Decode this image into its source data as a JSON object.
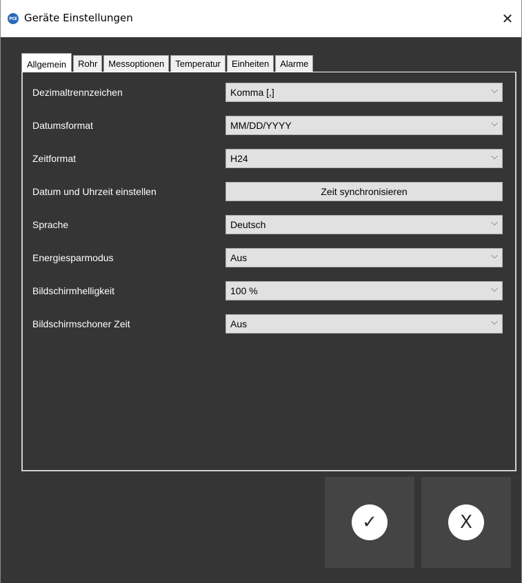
{
  "window": {
    "title": "Geräte Einstellungen",
    "icon_text": "PCE",
    "close_glyph": "✕"
  },
  "tabs": [
    {
      "label": "Allgemein",
      "active": true
    },
    {
      "label": "Rohr"
    },
    {
      "label": "Messoptionen"
    },
    {
      "label": "Temperatur"
    },
    {
      "label": "Einheiten"
    },
    {
      "label": "Alarme"
    }
  ],
  "settings": [
    {
      "label": "Dezimaltrennzeichen",
      "value": "Komma [,]",
      "type": "dropdown"
    },
    {
      "label": "Datumsformat",
      "value": "MM/DD/YYYY",
      "type": "dropdown"
    },
    {
      "label": "Zeitformat",
      "value": "H24",
      "type": "dropdown"
    },
    {
      "label": "Datum und Uhrzeit einstellen",
      "value": "Zeit synchronisieren",
      "type": "button"
    },
    {
      "label": "Sprache",
      "value": "Deutsch",
      "type": "dropdown"
    },
    {
      "label": "Energiesparmodus",
      "value": "Aus",
      "type": "dropdown"
    },
    {
      "label": "Bildschirmhelligkeit",
      "value": "100 %",
      "type": "dropdown"
    },
    {
      "label": "Bildschirmschoner Zeit",
      "value": "Aus",
      "type": "dropdown"
    }
  ],
  "icons": {
    "dropdown": "chevron-down-icon",
    "ok": "checkmark-icon",
    "cancel": "x-icon",
    "chevron_glyph": "⌵",
    "ok_glyph": "✓",
    "cancel_glyph": "X"
  },
  "colors": {
    "background": "#353535",
    "button_bg": "#444444",
    "control_bg": "#e1e1e1"
  }
}
